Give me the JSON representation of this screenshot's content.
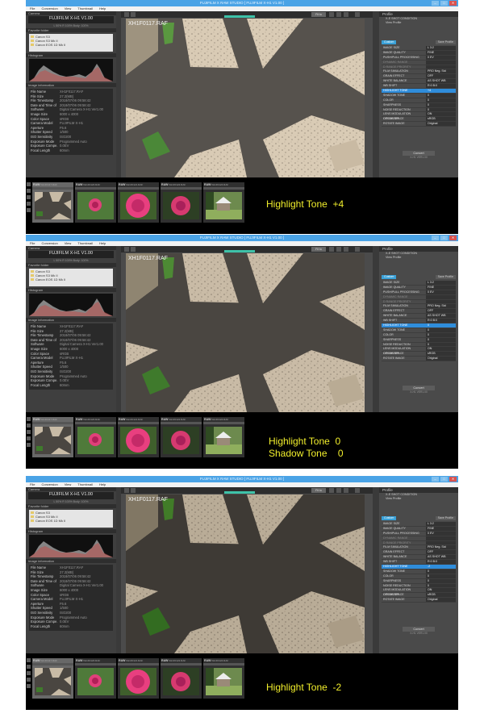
{
  "window": {
    "title": "FUJIFILM X RAW STUDIO    [ FUJIFILM X-H1    V1.00 ]",
    "minimize": "–",
    "maximize": "□",
    "close": "✕"
  },
  "menu": [
    "File",
    "Conversion",
    "View",
    "Thumbnail",
    "Help"
  ],
  "left_panel": {
    "camera_header": "Camera",
    "camera_name": "FUJIFILM X-H1   V1.00",
    "camera_sub": "L 50% R 100% Body: 100%",
    "favorites_header": "Favorite folder",
    "favorites": [
      "Canon S3",
      "Canon S3 Mk II",
      "Canon EOS 1D Mk II"
    ],
    "histogram_header": "Histogram",
    "info_header": "Image information",
    "info": [
      {
        "k": "File Name",
        "v": "XH1F0117.RAF"
      },
      {
        "k": "File Size",
        "v": "27.2(MB)"
      },
      {
        "k": "File Timestamp",
        "v": "2018/07/06 09:58:42"
      },
      {
        "k": "Date and Time of",
        "v": "2018/07/06 09:58:42"
      },
      {
        "k": "Software",
        "v": "Digital Camera X-H1 Ver1.00"
      },
      {
        "k": "Image Size",
        "v": "6000 x 4000"
      },
      {
        "k": "Color Space",
        "v": "sRGB"
      },
      {
        "k": "Camera Model",
        "v": "FUJIFILM X-H1"
      },
      {
        "k": "Aperture",
        "v": "F5.6"
      },
      {
        "k": "Shutter Speed",
        "v": "1/500"
      },
      {
        "k": "ISO Sensitivity",
        "v": "ISO200"
      },
      {
        "k": "Exposure Mode",
        "v": "Programmed Auto"
      },
      {
        "k": "Exposure Compe.",
        "v": "0.0EV"
      },
      {
        "k": "Focal Length",
        "v": "60mm"
      }
    ]
  },
  "viewer": {
    "zoom": "Fit to",
    "file_name": "XH1F0117.RAF"
  },
  "right_panel": {
    "profile_header": "Profile",
    "profile_options": [
      "X-E SHOT CONDITION",
      "View Profile"
    ],
    "tab_custom": "Custom",
    "tab_save": "Save Profile",
    "convert": "Convert",
    "convert_sub": "X-H1 VER1.00"
  },
  "thumbnails": [
    {
      "label": "RAW",
      "name": "XH1F0117.RAF",
      "kind": "shadow",
      "selected": true
    },
    {
      "label": "RAW",
      "name": "XH1F0120.RAF",
      "kind": "rose-small",
      "selected": false
    },
    {
      "label": "RAW",
      "name": "XH1F0121.RAF",
      "kind": "rose-large",
      "selected": false
    },
    {
      "label": "RAW",
      "name": "XH1F0122.RAF",
      "kind": "rose-dark",
      "selected": false
    },
    {
      "label": "RAW",
      "name": "XH1F0124.RAF",
      "kind": "pavilion",
      "selected": false
    }
  ],
  "screens": [
    {
      "caption": "Highlight Tone  +4",
      "params": [
        {
          "name": "IMAGE SIZE",
          "value": "L 3:2"
        },
        {
          "name": "IMAGE QUALITY",
          "value": "FINE"
        },
        {
          "name": "PUSH/PULL PROCESSING",
          "value": "0 EV"
        },
        {
          "name": "DYNAMIC RANGE",
          "value": ""
        },
        {
          "name": "D RANGE PRIORITY",
          "value": ""
        },
        {
          "name": "FILM SIMULATION",
          "value": "PRO Neg. Std"
        },
        {
          "name": "GRAIN EFFECT",
          "value": "OFF"
        },
        {
          "name": "WHITE BALANCE",
          "value": "AS SHOT WB"
        },
        {
          "name": "WB SHIFT",
          "value": "R:0 B:0"
        },
        {
          "name": "HIGHLIGHT TONE",
          "value": "+4"
        },
        {
          "name": "SHADOW TONE",
          "value": "0"
        },
        {
          "name": "COLOR",
          "value": "0"
        },
        {
          "name": "SHARPNESS",
          "value": "0"
        },
        {
          "name": "NOISE REDUCTION",
          "value": "0"
        },
        {
          "name": "LENS MODULATION OPTIMIZER",
          "value": "ON"
        },
        {
          "name": "COLOR SPACE",
          "value": "sRGB"
        },
        {
          "name": "ROTATE IMAGE",
          "value": "Original"
        }
      ],
      "photo_tone": "bright"
    },
    {
      "caption": "Highlight Tone  0\nShadow Tone    0",
      "params": [
        {
          "name": "IMAGE SIZE",
          "value": "L 3:2"
        },
        {
          "name": "IMAGE QUALITY",
          "value": "FINE"
        },
        {
          "name": "PUSH/PULL PROCESSING",
          "value": "0 EV"
        },
        {
          "name": "DYNAMIC RANGE",
          "value": ""
        },
        {
          "name": "D RANGE PRIORITY",
          "value": ""
        },
        {
          "name": "FILM SIMULATION",
          "value": "PRO Neg. Std"
        },
        {
          "name": "GRAIN EFFECT",
          "value": "OFF"
        },
        {
          "name": "WHITE BALANCE",
          "value": "AS SHOT WB"
        },
        {
          "name": "WB SHIFT",
          "value": "R:0 B:0"
        },
        {
          "name": "HIGHLIGHT TONE",
          "value": "0"
        },
        {
          "name": "SHADOW TONE",
          "value": "0"
        },
        {
          "name": "COLOR",
          "value": "0"
        },
        {
          "name": "SHARPNESS",
          "value": "0"
        },
        {
          "name": "NOISE REDUCTION",
          "value": "0"
        },
        {
          "name": "LENS MODULATION OPTIMIZER",
          "value": "ON"
        },
        {
          "name": "COLOR SPACE",
          "value": "sRGB"
        },
        {
          "name": "ROTATE IMAGE",
          "value": "Original"
        }
      ],
      "photo_tone": "normal"
    },
    {
      "caption": "Highlight Tone  -2",
      "params": [
        {
          "name": "IMAGE SIZE",
          "value": "L 3:2"
        },
        {
          "name": "IMAGE QUALITY",
          "value": "FINE"
        },
        {
          "name": "PUSH/PULL PROCESSING",
          "value": "0 EV"
        },
        {
          "name": "DYNAMIC RANGE",
          "value": ""
        },
        {
          "name": "D RANGE PRIORITY",
          "value": ""
        },
        {
          "name": "FILM SIMULATION",
          "value": "PRO Neg. Std"
        },
        {
          "name": "GRAIN EFFECT",
          "value": "OFF"
        },
        {
          "name": "WHITE BALANCE",
          "value": "AS SHOT WB"
        },
        {
          "name": "WB SHIFT",
          "value": "R:0 B:0"
        },
        {
          "name": "HIGHLIGHT TONE",
          "value": "-2"
        },
        {
          "name": "SHADOW TONE",
          "value": "0"
        },
        {
          "name": "COLOR",
          "value": "0"
        },
        {
          "name": "SHARPNESS",
          "value": "0"
        },
        {
          "name": "NOISE REDUCTION",
          "value": "0"
        },
        {
          "name": "LENS MODULATION OPTIMIZER",
          "value": "ON"
        },
        {
          "name": "COLOR SPACE",
          "value": "sRGB"
        },
        {
          "name": "ROTATE IMAGE",
          "value": "Original"
        }
      ],
      "photo_tone": "dark"
    }
  ],
  "colors": {
    "caption": "#f2ef2c",
    "titlebar": "#4aa3e6",
    "highlight_row": "#2f8ddb",
    "teal_marker": "#3ec2a8"
  }
}
